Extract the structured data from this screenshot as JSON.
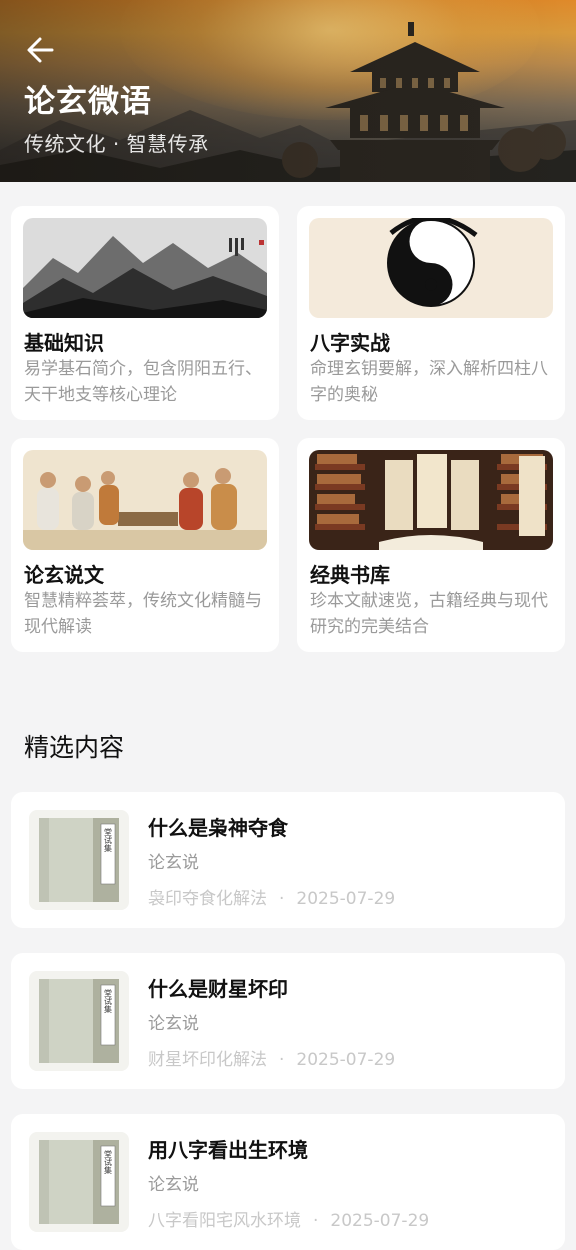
{
  "header": {
    "title": "论玄微语",
    "subtitle": "传统文化 · 智慧传承"
  },
  "categories": [
    {
      "title": "基础知识",
      "desc": "易学基石简介，包含阴阳五行、天干地支等核心理论",
      "thumb": "ink-mountains"
    },
    {
      "title": "八字实战",
      "desc": "命理玄钥要解，深入解析四柱八字的奥秘",
      "thumb": "yin-yang"
    },
    {
      "title": "论玄说文",
      "desc": "智慧精粹荟萃，传统文化精髓与现代解读",
      "thumb": "ancient-scholars"
    },
    {
      "title": "经典书库",
      "desc": "珍本文献速览，古籍经典与现代研究的完美结合",
      "thumb": "ancient-library"
    }
  ],
  "featured": {
    "section_title": "精选内容",
    "articles": [
      {
        "title": "什么是枭神夺食",
        "category": "论玄说",
        "tag": "袅印夺食化解法",
        "date": "2025-07-29"
      },
      {
        "title": "什么是财星坏印",
        "category": "论玄说",
        "tag": "财星坏印化解法",
        "date": "2025-07-29"
      },
      {
        "title": "用八字看出生环境",
        "category": "论玄说",
        "tag": "八字看阳宅风水环境",
        "date": "2025-07-29"
      }
    ]
  },
  "book_cover_text": "堂试集",
  "colors": {
    "page_bg": "#f4f4f5",
    "card_bg": "#ffffff",
    "text_primary": "#111111",
    "text_secondary": "#9a9a9a",
    "text_muted": "#c8c8c8"
  }
}
